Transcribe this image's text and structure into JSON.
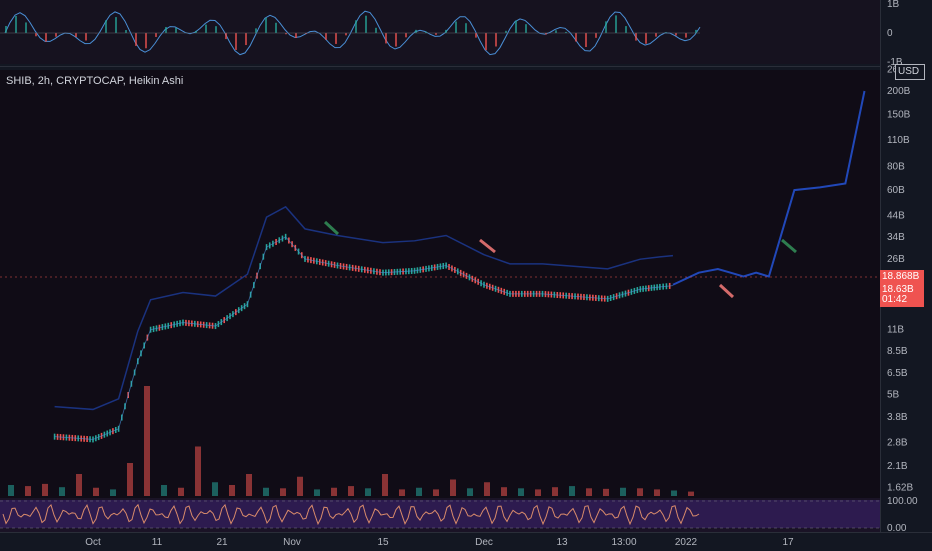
{
  "symbol_legend": "SHIB, 2h, CRYPTOCAP, Heikin Ashi",
  "currency_badge": "USD",
  "price_badges": {
    "last": "18.868B",
    "prev": "18.63B",
    "countdown": "01:42"
  },
  "colors": {
    "bull": "#26a69a",
    "bear": "#ef5350",
    "ma_blue": "#2962ff",
    "fast": "#4a8fd6",
    "osc_line": "#d98b6b",
    "green_arrow": "#2e7d4f",
    "red_arrow": "#d46a6a"
  },
  "top_axis": {
    "labels": [
      "1B",
      "0",
      "-1B"
    ]
  },
  "osc_axis": {
    "labels": [
      "100.00",
      "0.00"
    ]
  },
  "chart_data": {
    "type": "line",
    "title": "SHIB, 2h, CRYPTOCAP, Heikin Ashi",
    "y_scale": "log",
    "ylim": [
      1500000000,
      260000000000
    ],
    "y_tick_labels": [
      "260B",
      "200B",
      "150B",
      "110B",
      "80B",
      "60B",
      "44B",
      "34B",
      "26B",
      "19B",
      "15B",
      "11B",
      "8.5B",
      "6.5B",
      "5B",
      "3.8B",
      "2.8B",
      "2.1B",
      "1.62B"
    ],
    "y_tick_values": [
      260,
      200,
      150,
      110,
      80,
      60,
      44,
      34,
      26,
      19,
      15,
      11,
      8.5,
      6.5,
      5,
      3.8,
      2.8,
      2.1,
      1.62
    ],
    "x_tick_labels": [
      "Oct",
      "11",
      "21",
      "Nov",
      "15",
      "Dec",
      "13",
      "13:00",
      "2022",
      "17"
    ],
    "series": [
      {
        "role": "price",
        "x": [
          "2021-09-25",
          "2021-10-01",
          "2021-10-05",
          "2021-10-08",
          "2021-10-10",
          "2021-10-15",
          "2021-10-20",
          "2021-10-25",
          "2021-10-28",
          "2021-10-31",
          "2021-11-03",
          "2021-11-08",
          "2021-11-15",
          "2021-11-20",
          "2021-11-25",
          "2021-12-01",
          "2021-12-05",
          "2021-12-10",
          "2021-12-15",
          "2021-12-20",
          "2021-12-25",
          "2021-12-28",
          "2021-12-30"
        ],
        "y": [
          3.0,
          2.9,
          3.3,
          7.5,
          11,
          12,
          11.5,
          15,
          30,
          34,
          26,
          24,
          22,
          22.5,
          24,
          19,
          17,
          17,
          16.5,
          16,
          18,
          18.5,
          18.8
        ]
      },
      {
        "role": "projection",
        "x": [
          "2021-12-30",
          "2022-01-03",
          "2022-01-06",
          "2022-01-08",
          "2022-01-10",
          "2022-01-12",
          "2022-01-14",
          "2022-01-18",
          "2022-01-22",
          "2022-01-26",
          "2022-01-29"
        ],
        "y": [
          19,
          22,
          23,
          22,
          21,
          22,
          21,
          60,
          62,
          65,
          200
        ]
      }
    ]
  },
  "volume": [
    20,
    18,
    22,
    16,
    40,
    15,
    12,
    60,
    200,
    20,
    15,
    90,
    25,
    20,
    40,
    15,
    14,
    35,
    12,
    15,
    18,
    14,
    40,
    12,
    15,
    12,
    30,
    14,
    25,
    16,
    14,
    12,
    16,
    18,
    14,
    13,
    15,
    14,
    12,
    10,
    8
  ]
}
